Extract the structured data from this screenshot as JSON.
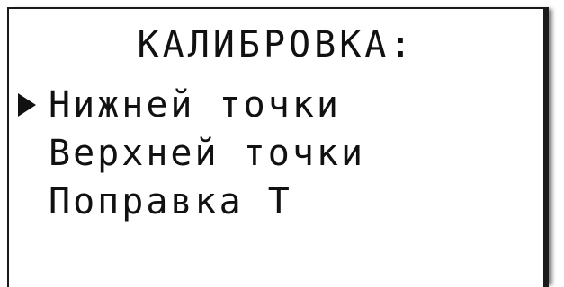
{
  "screen": {
    "title": "КАЛИБРОВКА:"
  },
  "menu": {
    "selected_index": 0,
    "items": [
      {
        "label": "Нижней точки",
        "selected": true
      },
      {
        "label": "Верхней точки",
        "selected": false
      },
      {
        "label": "Поправка Т",
        "selected": false
      }
    ]
  },
  "colors": {
    "text": "#111111",
    "background": "#ffffff",
    "frame": "#1a1a1a"
  },
  "icons": {
    "selector": "selector-arrow-icon"
  }
}
